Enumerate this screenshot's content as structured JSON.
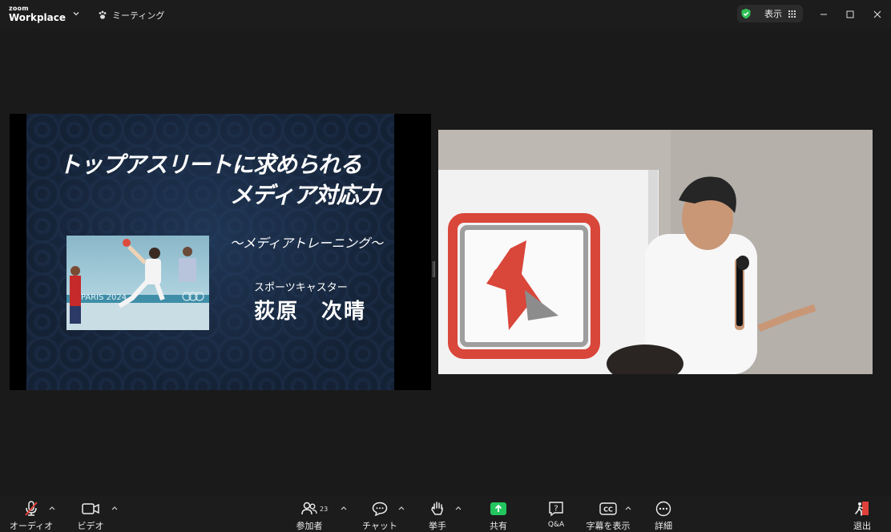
{
  "app": {
    "brand_small": "zoom",
    "brand_large": "Workplace",
    "meeting_label": "ミーティング",
    "view_label": "表示"
  },
  "slide": {
    "title_line1": "トップアスリートに求められる",
    "title_line2": "メディア対応力",
    "subtitle": "～メディアトレーニング～",
    "role": "スポーツキャスター",
    "name": "荻原　次晴",
    "photo_text": "PARIS 2024"
  },
  "toolbar": {
    "audio": "オーディオ",
    "video": "ビデオ",
    "participants": "参加者",
    "participants_count": "23",
    "chat": "チャット",
    "raise_hand": "挙手",
    "share": "共有",
    "qa": "Q&A",
    "captions": "字幕を表示",
    "more": "詳細",
    "leave": "退出"
  },
  "colors": {
    "share_green": "#23c55e",
    "mute_red": "#e0403a",
    "shield_green": "#2fbf55"
  }
}
